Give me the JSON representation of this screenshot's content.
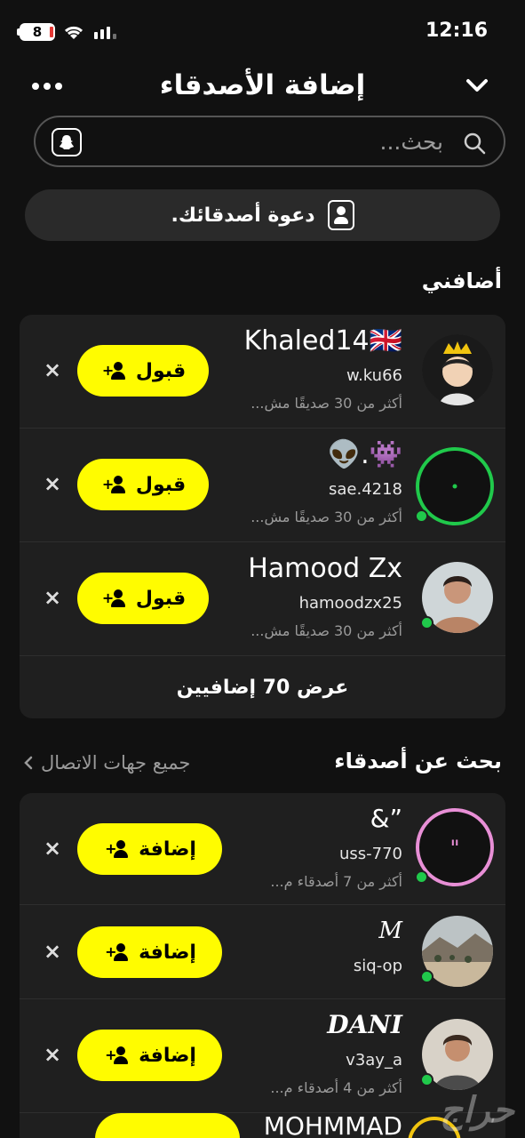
{
  "status_bar": {
    "battery_level": "8",
    "time": "12:16"
  },
  "header": {
    "title": "إضافة الأصدقاء"
  },
  "search": {
    "placeholder": "بحث..."
  },
  "invite": {
    "label": "دعوة أصدقائك."
  },
  "added_me": {
    "title": "أضافني",
    "accept_label": "قبول",
    "view_all_label": "عرض 70 إضافيين",
    "rows": [
      {
        "name": "Khaled14🇬🇧",
        "username": "w.ku66",
        "subtitle": "أكثر من 30 صديقًا مش...",
        "avatar_icon": "crowned-cartoon-avatar",
        "online": false
      },
      {
        "name": "👽.👾",
        "username": "sae.4218",
        "subtitle": "أكثر من 30 صديقًا مش...",
        "avatar_icon": "story-ring-avatar",
        "online": true
      },
      {
        "name": "Hamood Zx",
        "username": "hamoodzx25",
        "subtitle": "أكثر من 30 صديقًا مش...",
        "avatar_icon": "photo-avatar",
        "online": true
      }
    ]
  },
  "find_friends": {
    "title": "بحث عن أصدقاء",
    "all_contacts_label": "جميع جهات الاتصال",
    "add_label": "إضافة",
    "rows": [
      {
        "name": "&”",
        "username": "uss-770",
        "subtitle": "أكثر من 7 أصدقاء م...",
        "avatar_icon": "pink-ring-avatar",
        "online": true
      },
      {
        "name": "M",
        "username": "siq-op",
        "subtitle": "",
        "avatar_icon": "landscape-photo-avatar",
        "online": true
      },
      {
        "name": "DANI",
        "username": "v3ay_a",
        "subtitle": "أكثر من 4 أصدقاء م...",
        "avatar_icon": "photo-avatar",
        "online": true
      }
    ],
    "partial_next_name": "MOHMMAD"
  },
  "watermark": "حراج",
  "colors": {
    "accent": "#fffc00",
    "background": "#111111",
    "card": "#1f1f1f",
    "online": "#20c94b"
  }
}
